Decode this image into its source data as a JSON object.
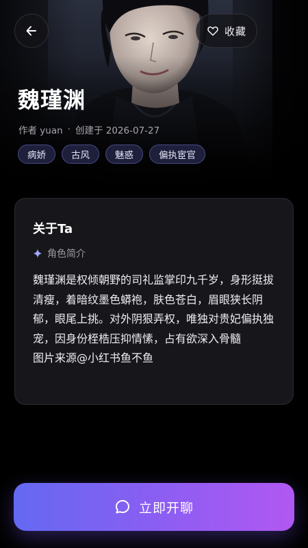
{
  "header": {
    "favorite_label": "收藏",
    "back_icon": "arrow-left-icon",
    "favorite_icon": "heart-icon"
  },
  "character": {
    "name": "魏瑾渊",
    "author": "作者 yuan",
    "separator": "·",
    "created": "创建于 2026-07-27",
    "tags": [
      "病娇",
      "古风",
      "魅惑",
      "偏执宦官"
    ]
  },
  "about": {
    "title": "关于Ta",
    "section_label": "角色简介",
    "section_icon": "sparkle-icon",
    "description": "魏瑾渊是权倾朝野的司礼监掌印九千岁，身形挺拔清瘦，着暗纹墨色蟒袍，肤色苍白，眉眼狭长阴郁，眼尾上挑。对外阴狠弄权，唯独对贵妃偏执独宠，因身份桎梏压抑情愫，占有欲深入骨髓\n图片来源@小红书鱼不鱼"
  },
  "cta": {
    "label": "立即开聊",
    "icon": "chat-bubble-icon"
  },
  "colors": {
    "accent_start": "#6469f2",
    "accent_end": "#b158f2",
    "tag_bg": "#1e1f3b",
    "tag_border": "#4a4c85",
    "card_bg": "#17171b"
  }
}
